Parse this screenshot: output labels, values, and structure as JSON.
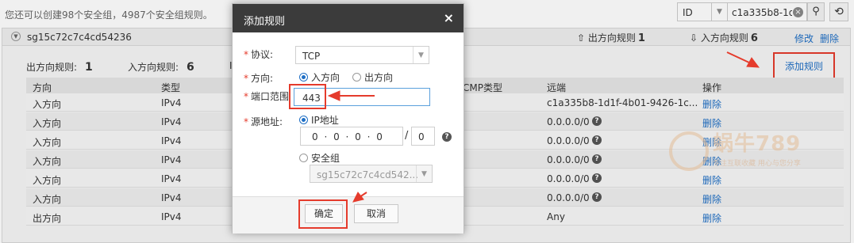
{
  "topbar": {
    "info": "您还可以创建98个安全组，4987个安全组规则。",
    "filter_value": "ID",
    "search_value": "c1a335b8-1d1"
  },
  "sg": {
    "name": "sg15c72c7c4cd54236",
    "outbound_label": "出方向规则",
    "outbound_count": "1",
    "inbound_label": "入方向规则",
    "inbound_count": "6",
    "edit": "修改",
    "delete": "删除",
    "count_out_label": "出方向规则:",
    "count_out": "1",
    "count_in_label": "入方向规则:",
    "count_in": "6",
    "count_more": "I",
    "add_rule": "添加规则"
  },
  "table": {
    "headers": [
      "方向",
      "类型",
      "CMP类型",
      "远端",
      "操作"
    ],
    "rows": [
      {
        "dir": "入方向",
        "type": "IPv4",
        "remote": "c1a335b8-1d1f-4b01-9426-1c...",
        "op": "删除",
        "help": false
      },
      {
        "dir": "入方向",
        "type": "IPv4",
        "remote": "0.0.0.0/0",
        "op": "删除",
        "help": true
      },
      {
        "dir": "入方向",
        "type": "IPv4",
        "remote": "0.0.0.0/0",
        "op": "删除",
        "help": true
      },
      {
        "dir": "入方向",
        "type": "IPv4",
        "remote": "0.0.0.0/0",
        "op": "删除",
        "help": true
      },
      {
        "dir": "入方向",
        "type": "IPv4",
        "remote": "0.0.0.0/0",
        "op": "删除",
        "help": true
      },
      {
        "dir": "入方向",
        "type": "IPv4",
        "remote": "0.0.0.0/0",
        "op": "删除",
        "help": true
      },
      {
        "dir": "出方向",
        "type": "IPv4",
        "remote": "Any",
        "op": "删除",
        "help": false
      }
    ],
    "help_glyph": "?"
  },
  "dialog": {
    "title": "添加规则",
    "close": "×",
    "protocol_label": "协议:",
    "protocol_value": "TCP",
    "direction_label": "方向:",
    "direction_in": "入方向",
    "direction_out": "出方向",
    "port_label": "端口范围",
    "port_value": "443",
    "source_label": "源地址:",
    "source_ip": "IP地址",
    "ip_value": "0 · 0 · 0 · 0",
    "mask_value": "0",
    "source_sg": "安全组",
    "sg_select_value": "sg15c72c7c4cd542...",
    "confirm": "确定",
    "cancel": "取消"
  },
  "watermark": {
    "text": "蜗牛789",
    "sub": "专注互联收藏  用心与您分享"
  },
  "colors": {
    "link": "#1f6fc5",
    "highlight": "#e53b2c",
    "dialog_header": "#3b3b3b"
  }
}
